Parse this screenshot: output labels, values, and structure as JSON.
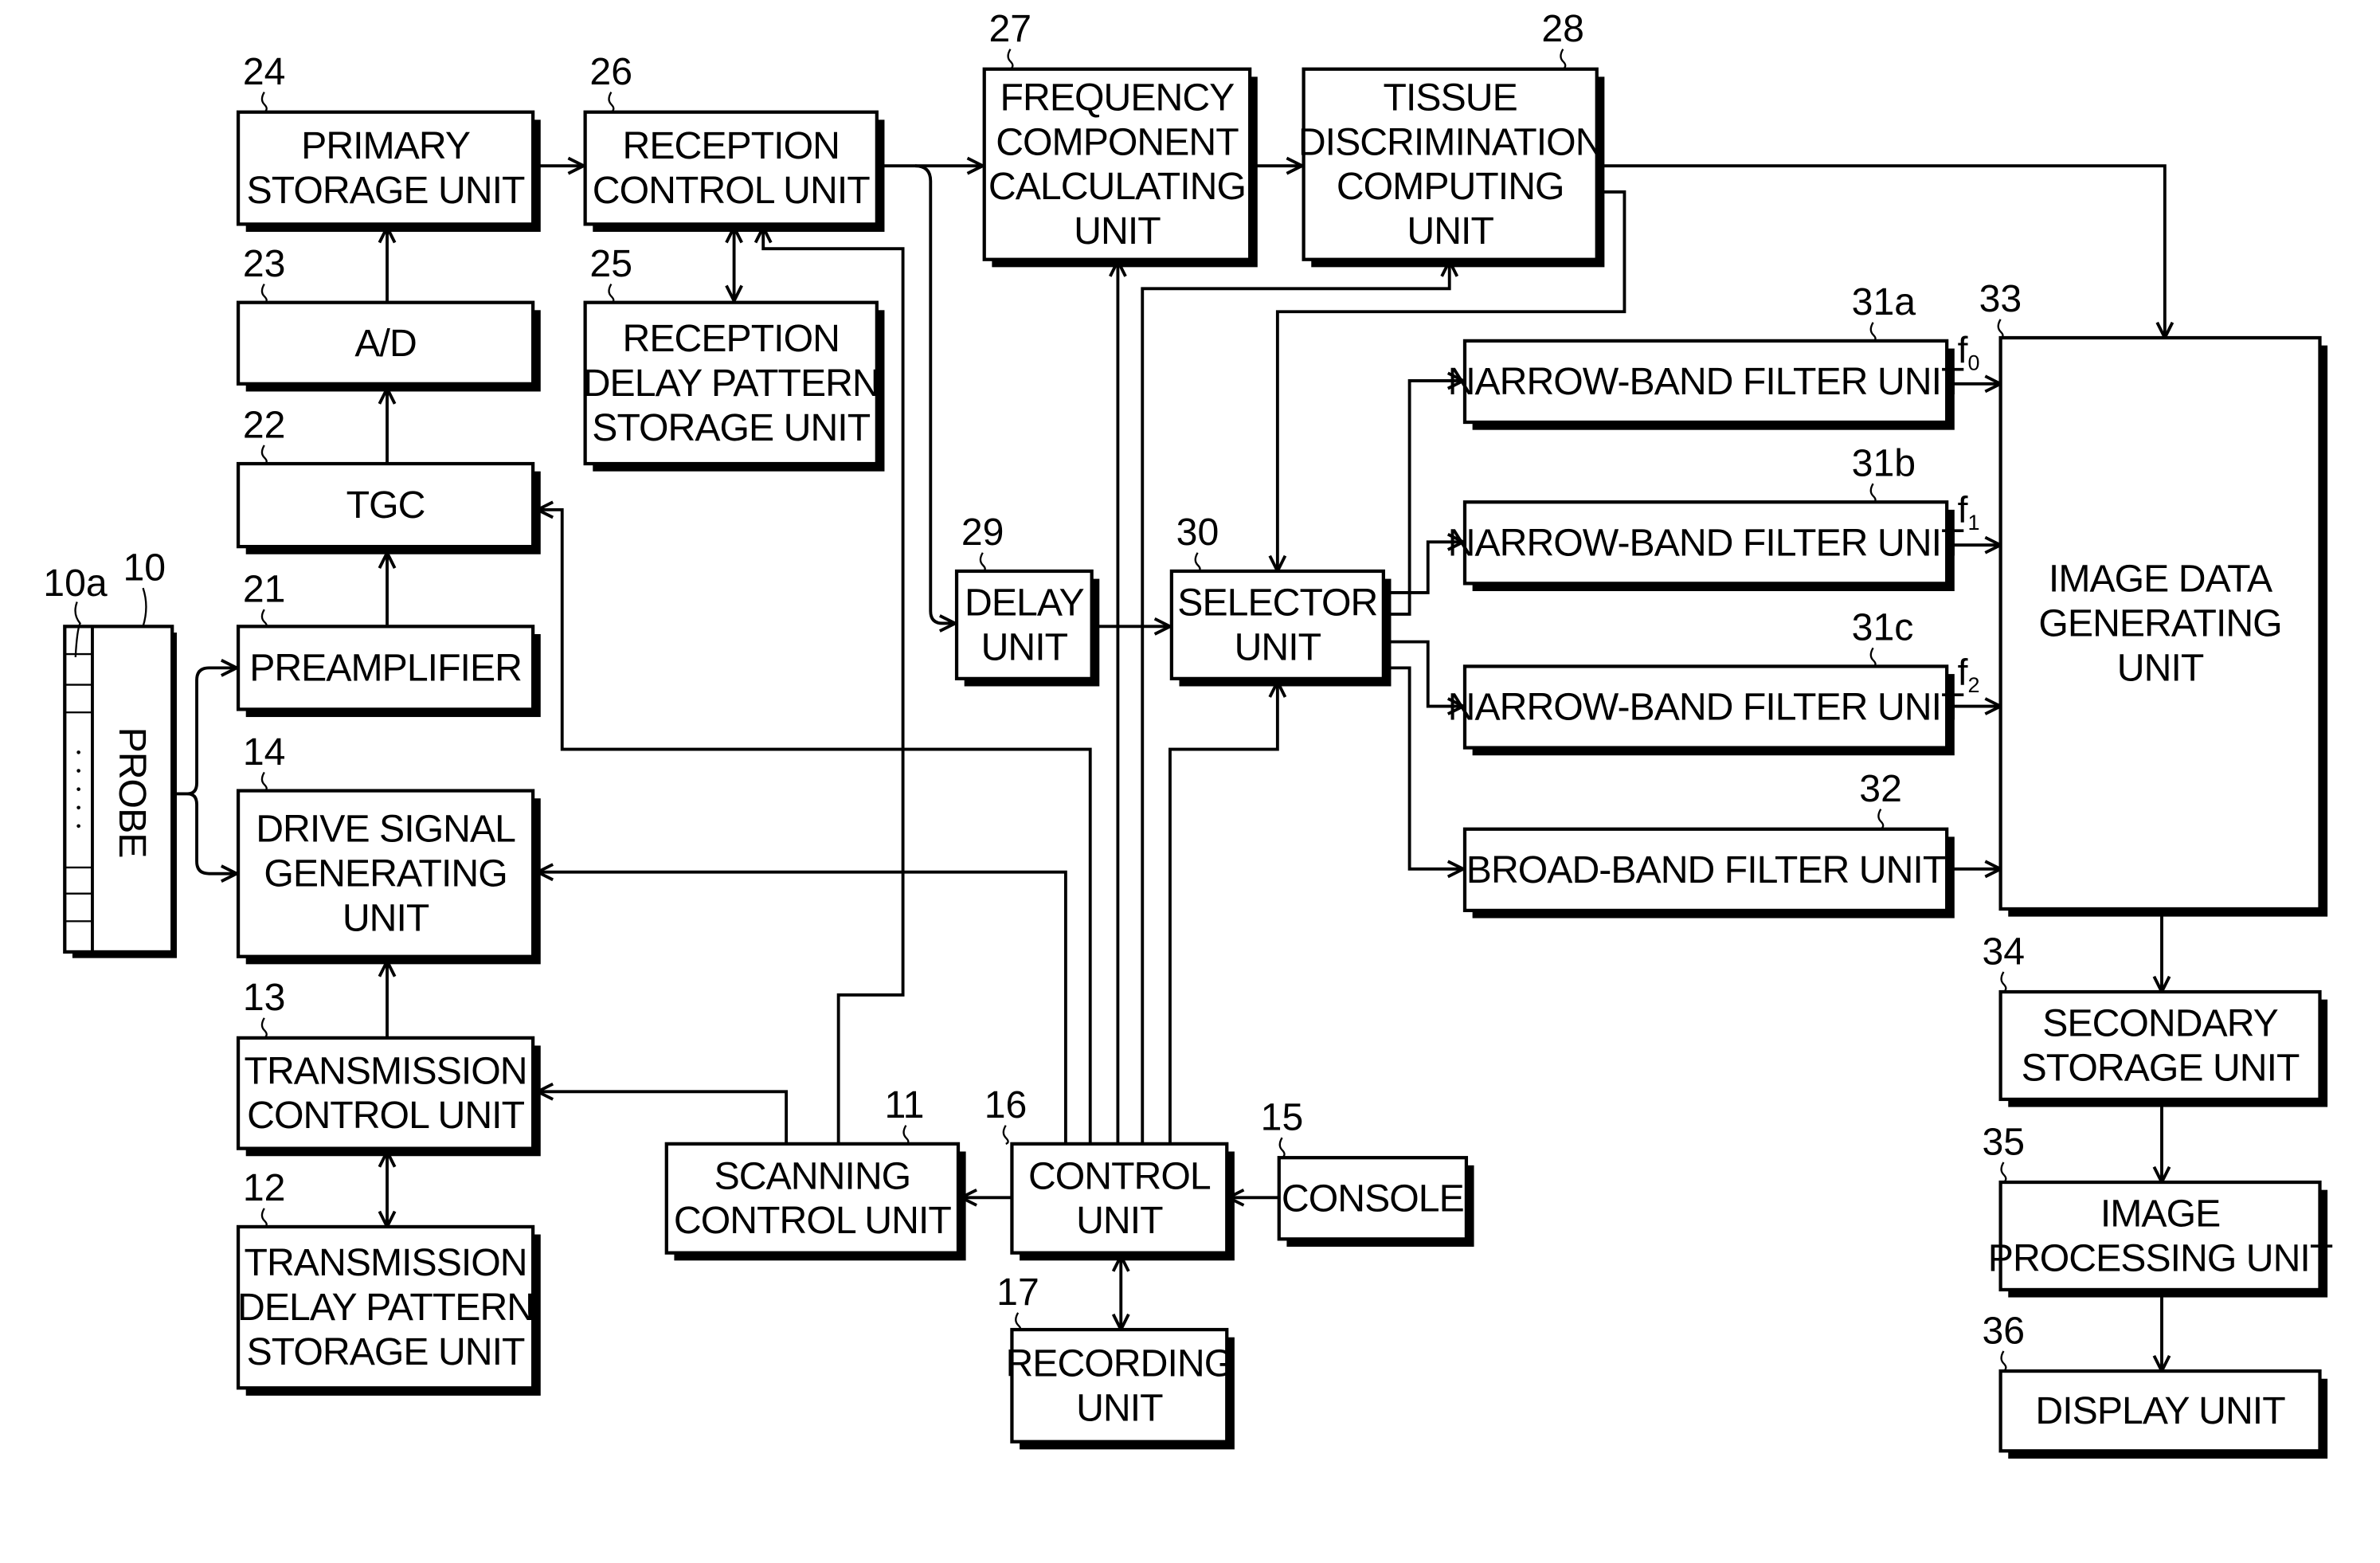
{
  "diagram": {
    "blocks": [
      {
        "id": "probe",
        "ref": "10",
        "label": [
          "PROBE"
        ]
      },
      {
        "id": "preamplifier",
        "ref": "21",
        "label": [
          "PREAMPLIFIER"
        ]
      },
      {
        "id": "tgc",
        "ref": "22",
        "label": [
          "TGC"
        ]
      },
      {
        "id": "ad",
        "ref": "23",
        "label": [
          "A/D"
        ]
      },
      {
        "id": "primary-storage",
        "ref": "24",
        "label": [
          "PRIMARY",
          "STORAGE UNIT"
        ]
      },
      {
        "id": "reception-control",
        "ref": "26",
        "label": [
          "RECEPTION",
          "CONTROL UNIT"
        ]
      },
      {
        "id": "reception-delay-pattern",
        "ref": "25",
        "label": [
          "RECEPTION",
          "DELAY PATTERN",
          "STORAGE UNIT"
        ]
      },
      {
        "id": "frequency-component",
        "ref": "27",
        "label": [
          "FREQUENCY",
          "COMPONENT",
          "CALCULATING",
          "UNIT"
        ]
      },
      {
        "id": "tissue-discrimination",
        "ref": "28",
        "label": [
          "TISSUE",
          "DISCRIMINATION",
          "COMPUTING",
          "UNIT"
        ]
      },
      {
        "id": "delay-unit",
        "ref": "29",
        "label": [
          "DELAY",
          "UNIT"
        ]
      },
      {
        "id": "selector-unit",
        "ref": "30",
        "label": [
          "SELECTOR",
          "UNIT"
        ]
      },
      {
        "id": "narrow-band-a",
        "ref": "31a",
        "label": [
          "NARROW-BAND FILTER UNIT"
        ]
      },
      {
        "id": "narrow-band-b",
        "ref": "31b",
        "label": [
          "NARROW-BAND FILTER UNIT"
        ]
      },
      {
        "id": "narrow-band-c",
        "ref": "31c",
        "label": [
          "NARROW-BAND FILTER UNIT"
        ]
      },
      {
        "id": "broad-band",
        "ref": "32",
        "label": [
          "BROAD-BAND FILTER UNIT"
        ]
      },
      {
        "id": "image-data-generating",
        "ref": "33",
        "label": [
          "IMAGE DATA",
          "GENERATING",
          "UNIT"
        ]
      },
      {
        "id": "secondary-storage",
        "ref": "34",
        "label": [
          "SECONDARY",
          "STORAGE UNIT"
        ]
      },
      {
        "id": "image-processing",
        "ref": "35",
        "label": [
          "IMAGE",
          "PROCESSING UNIT"
        ]
      },
      {
        "id": "display-unit",
        "ref": "36",
        "label": [
          "DISPLAY UNIT"
        ]
      },
      {
        "id": "drive-signal",
        "ref": "14",
        "label": [
          "DRIVE SIGNAL",
          "GENERATING",
          "UNIT"
        ]
      },
      {
        "id": "transmission-control",
        "ref": "13",
        "label": [
          "TRANSMISSION",
          "CONTROL UNIT"
        ]
      },
      {
        "id": "transmission-delay-pattern",
        "ref": "12",
        "label": [
          "TRANSMISSION",
          "DELAY PATTERN",
          "STORAGE UNIT"
        ]
      },
      {
        "id": "scanning-control",
        "ref": "11",
        "label": [
          "SCANNING",
          "CONTROL UNIT"
        ]
      },
      {
        "id": "control-unit",
        "ref": "16",
        "label": [
          "CONTROL",
          "UNIT"
        ]
      },
      {
        "id": "console",
        "ref": "15",
        "label": [
          "CONSOLE"
        ]
      },
      {
        "id": "recording-unit",
        "ref": "17",
        "label": [
          "RECORDING",
          "UNIT"
        ]
      }
    ],
    "extra_refs": {
      "probe_elements": "10a"
    },
    "frequency_labels": {
      "f0": {
        "base": "f",
        "sub": "0"
      },
      "f1": {
        "base": "f",
        "sub": "1"
      },
      "f2": {
        "base": "f",
        "sub": "2"
      }
    },
    "connections": [
      {
        "from": "probe",
        "to": "preamplifier"
      },
      {
        "from": "drive-signal",
        "to": "probe"
      },
      {
        "from": "preamplifier",
        "to": "tgc"
      },
      {
        "from": "tgc",
        "to": "ad"
      },
      {
        "from": "ad",
        "to": "primary-storage"
      },
      {
        "from": "primary-storage",
        "to": "reception-control"
      },
      {
        "from": "reception-control",
        "to": "reception-delay-pattern",
        "bidirectional": true
      },
      {
        "from": "reception-control",
        "to": "frequency-component"
      },
      {
        "from": "reception-control",
        "to": "delay-unit"
      },
      {
        "from": "frequency-component",
        "to": "tissue-discrimination"
      },
      {
        "from": "tissue-discrimination",
        "to": "image-data-generating"
      },
      {
        "from": "tissue-discrimination",
        "to": "selector-unit"
      },
      {
        "from": "delay-unit",
        "to": "selector-unit"
      },
      {
        "from": "selector-unit",
        "to": "narrow-band-a"
      },
      {
        "from": "selector-unit",
        "to": "narrow-band-b"
      },
      {
        "from": "selector-unit",
        "to": "narrow-band-c"
      },
      {
        "from": "selector-unit",
        "to": "broad-band"
      },
      {
        "from": "narrow-band-a",
        "to": "image-data-generating",
        "label": "f0"
      },
      {
        "from": "narrow-band-b",
        "to": "image-data-generating",
        "label": "f1"
      },
      {
        "from": "narrow-band-c",
        "to": "image-data-generating",
        "label": "f2"
      },
      {
        "from": "broad-band",
        "to": "image-data-generating"
      },
      {
        "from": "image-data-generating",
        "to": "secondary-storage"
      },
      {
        "from": "secondary-storage",
        "to": "image-processing"
      },
      {
        "from": "image-processing",
        "to": "display-unit"
      },
      {
        "from": "transmission-control",
        "to": "drive-signal"
      },
      {
        "from": "transmission-control",
        "to": "transmission-delay-pattern",
        "bidirectional": true
      },
      {
        "from": "scanning-control",
        "to": "transmission-control"
      },
      {
        "from": "scanning-control",
        "to": "reception-control"
      },
      {
        "from": "control-unit",
        "to": "scanning-control"
      },
      {
        "from": "console",
        "to": "control-unit"
      },
      {
        "from": "control-unit",
        "to": "recording-unit",
        "bidirectional": true
      },
      {
        "from": "control-unit",
        "to": "tgc"
      },
      {
        "from": "control-unit",
        "to": "drive-signal"
      },
      {
        "from": "control-unit",
        "to": "frequency-component"
      },
      {
        "from": "control-unit",
        "to": "tissue-discrimination"
      },
      {
        "from": "control-unit",
        "to": "selector-unit"
      }
    ]
  }
}
